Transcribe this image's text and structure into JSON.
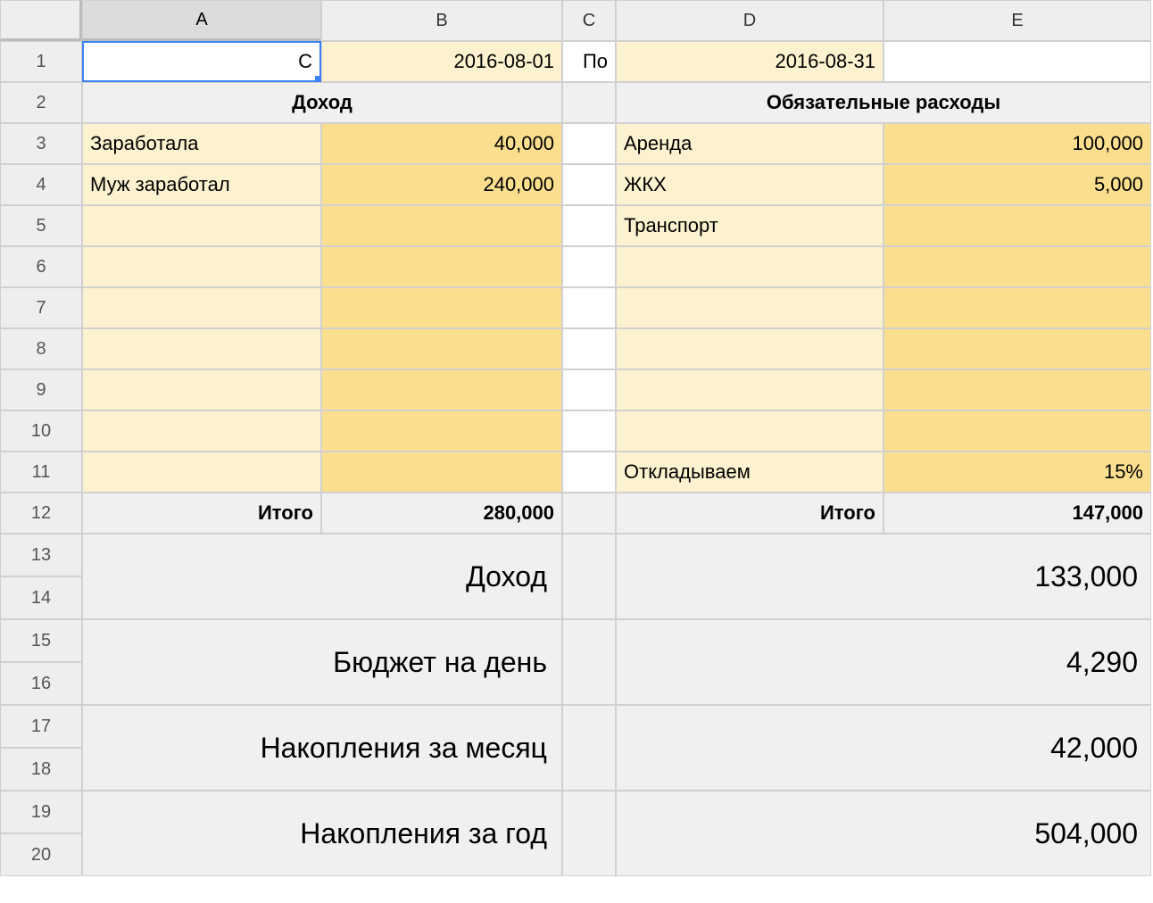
{
  "columns": [
    "A",
    "B",
    "C",
    "D",
    "E"
  ],
  "rows": [
    "1",
    "2",
    "3",
    "4",
    "5",
    "6",
    "7",
    "8",
    "9",
    "10",
    "11",
    "12",
    "13",
    "14",
    "15",
    "16",
    "17",
    "18",
    "19",
    "20"
  ],
  "r1": {
    "A": "С",
    "B": "2016-08-01",
    "C": "По",
    "D": "2016-08-31"
  },
  "r2": {
    "AB": "Доход",
    "DE": "Обязательные расходы"
  },
  "income": {
    "items": [
      {
        "label": "Заработала",
        "value": "40,000"
      },
      {
        "label": "Муж заработал",
        "value": "240,000"
      }
    ],
    "total_label": "Итого",
    "total_value": "280,000"
  },
  "expenses": {
    "items": [
      {
        "label": "Аренда",
        "value": "100,000"
      },
      {
        "label": "ЖКХ",
        "value": "5,000"
      },
      {
        "label": "Транспорт",
        "value": ""
      }
    ],
    "save_label": "Откладываем",
    "save_value": "15%",
    "total_label": "Итого",
    "total_value": "147,000"
  },
  "summary": [
    {
      "label": "Доход",
      "value": "133,000",
      "rows": [
        "13",
        "14"
      ]
    },
    {
      "label": "Бюджет на день",
      "value": "4,290",
      "rows": [
        "15",
        "16"
      ]
    },
    {
      "label": "Накопления за месяц",
      "value": "42,000",
      "rows": [
        "17",
        "18"
      ]
    },
    {
      "label": "Накопления за год",
      "value": "504,000",
      "rows": [
        "19",
        "20"
      ]
    }
  ]
}
